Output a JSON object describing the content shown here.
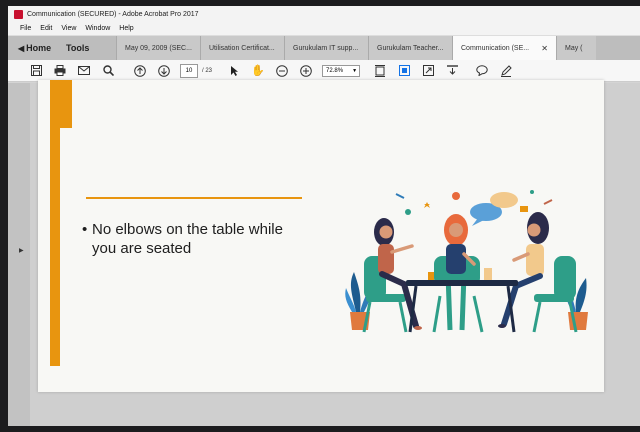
{
  "window": {
    "title": "Communication (SECURED) - Adobe Acrobat Pro 2017"
  },
  "menu": [
    "File",
    "Edit",
    "View",
    "Window",
    "Help"
  ],
  "nav": {
    "home": "Home",
    "tools": "Tools"
  },
  "tabs": [
    {
      "label": "May 09, 2009 (SEC..."
    },
    {
      "label": "Utilisation Certificat..."
    },
    {
      "label": "Gurukulam IT supp..."
    },
    {
      "label": "Gurukulam Teacher..."
    },
    {
      "label": "Communication (SE..."
    },
    {
      "label": "May ("
    }
  ],
  "toolbar": {
    "current_page": "10",
    "total_pages": "/ 23",
    "zoom": "72.8%",
    "icons": [
      "save-icon",
      "print-icon",
      "email-icon",
      "search-icon",
      "page-up-icon",
      "page-down-icon",
      "select-arrow-icon",
      "hand-icon",
      "zoom-out-icon",
      "zoom-in-icon",
      "fit-page-icon",
      "scroll-mode-icon",
      "fullscreen-icon",
      "read-mode-icon",
      "comment-icon",
      "pen-icon"
    ]
  },
  "slide": {
    "bullet_line1": "No elbows on the table while",
    "bullet_line2": "you are seated"
  },
  "colors": {
    "accent_orange": "#e8950f",
    "acrobat_blue": "#1473e6"
  }
}
